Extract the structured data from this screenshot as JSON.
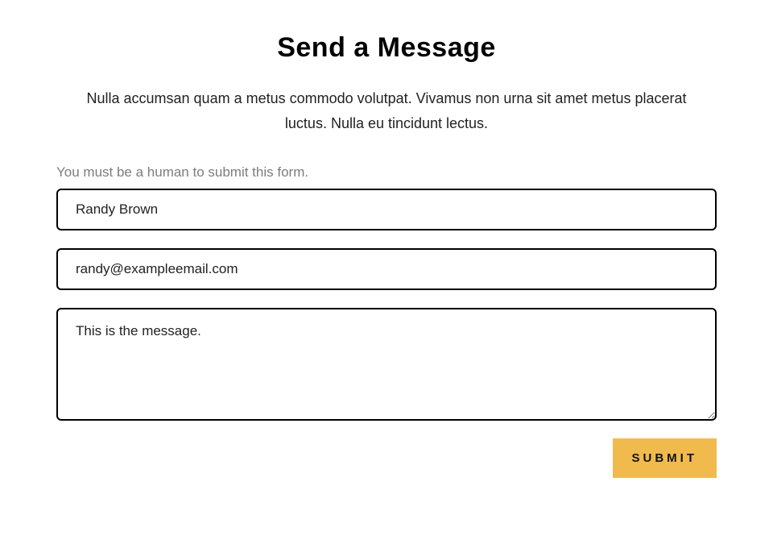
{
  "form": {
    "title": "Send a Message",
    "description": "Nulla accumsan quam a metus commodo volutpat. Vivamus non urna sit amet metus placerat luctus. Nulla eu tincidunt lectus.",
    "notice": "You must be a human to submit this form.",
    "fields": {
      "name": {
        "value": "Randy Brown"
      },
      "email": {
        "value": "randy@exampleemail.com"
      },
      "message": {
        "value": "This is the message."
      }
    },
    "submit_label": "SUBMIT",
    "colors": {
      "accent": "#f0bb4c",
      "border": "#000000",
      "notice_text": "#7d7d7d"
    }
  }
}
